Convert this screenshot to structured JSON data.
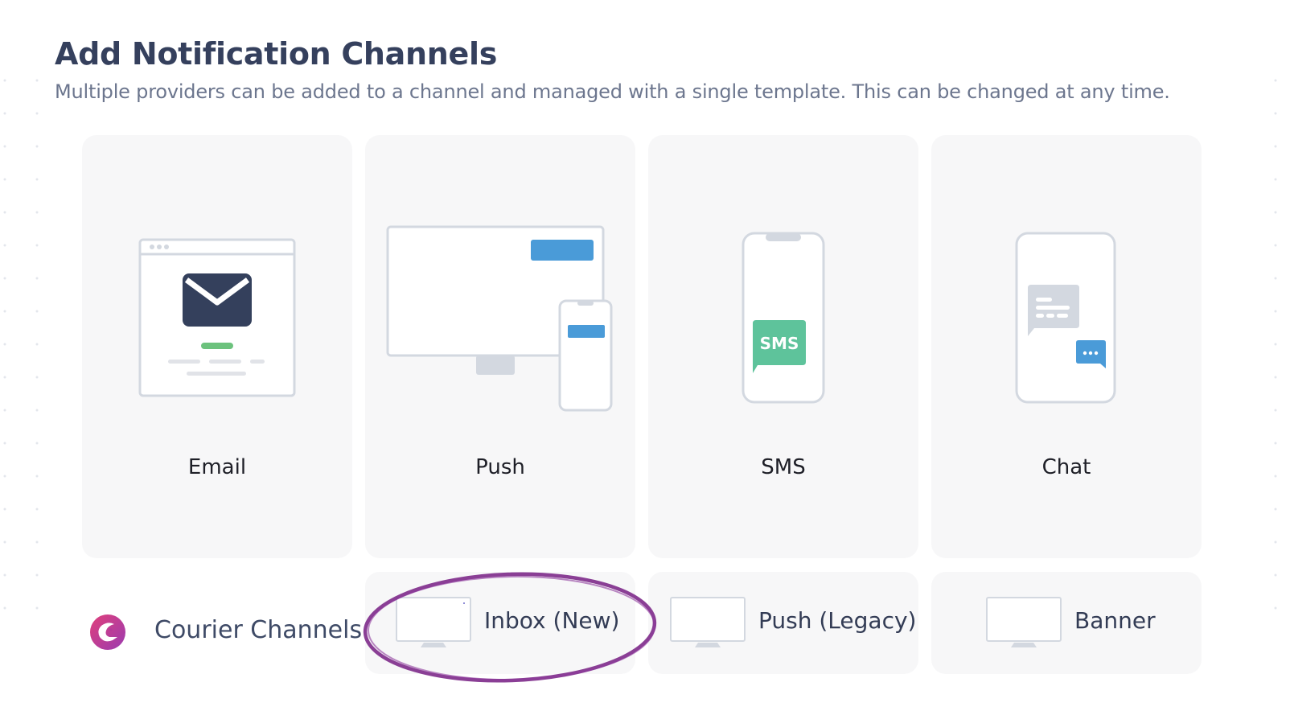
{
  "header": {
    "title": "Add Notification Channels",
    "subtitle": "Multiple providers can be added to a channel and managed with a single template. This can be changed at any time."
  },
  "channels": [
    {
      "label": "Email",
      "icon": "email-illustration-icon"
    },
    {
      "label": "Push",
      "icon": "push-illustration-icon"
    },
    {
      "label": "SMS",
      "icon": "sms-illustration-icon",
      "bubble_text": "SMS"
    },
    {
      "label": "Chat",
      "icon": "chat-illustration-icon"
    }
  ],
  "courier_channels": {
    "label": "Courier Channels",
    "items": [
      {
        "label": "Inbox (New)",
        "icon": "monitor-icon",
        "highlighted": true
      },
      {
        "label": "Push (Legacy)",
        "icon": "monitor-icon"
      },
      {
        "label": "Banner",
        "icon": "monitor-icon"
      }
    ]
  },
  "colors": {
    "title": "#35405d",
    "subtitle": "#6c768e",
    "card_bg": "#f7f7f8",
    "envelope": "#34405c",
    "accent_blue": "#4a9bd8",
    "sms_green": "#5ec39b",
    "highlight_purple": "#7d2a8a",
    "courier_gradient_start": "#e0407b",
    "courier_gradient_end": "#9b3bb0"
  }
}
